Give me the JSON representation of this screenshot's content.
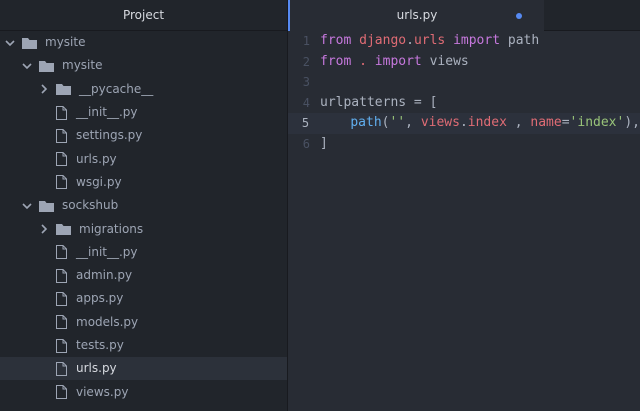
{
  "sidebar": {
    "title": "Project",
    "tree": [
      {
        "label": "mysite",
        "type": "folder",
        "depth": 0,
        "expanded": true
      },
      {
        "label": "mysite",
        "type": "folder",
        "depth": 1,
        "expanded": true
      },
      {
        "label": "__pycache__",
        "type": "folder",
        "depth": 2,
        "expanded": false
      },
      {
        "label": "__init__.py",
        "type": "file",
        "depth": 2
      },
      {
        "label": "settings.py",
        "type": "file",
        "depth": 2
      },
      {
        "label": "urls.py",
        "type": "file",
        "depth": 2
      },
      {
        "label": "wsgi.py",
        "type": "file",
        "depth": 2
      },
      {
        "label": "sockshub",
        "type": "folder",
        "depth": 1,
        "expanded": true
      },
      {
        "label": "migrations",
        "type": "folder",
        "depth": 2,
        "expanded": false
      },
      {
        "label": "__init__.py",
        "type": "file",
        "depth": 2
      },
      {
        "label": "admin.py",
        "type": "file",
        "depth": 2
      },
      {
        "label": "apps.py",
        "type": "file",
        "depth": 2
      },
      {
        "label": "models.py",
        "type": "file",
        "depth": 2
      },
      {
        "label": "tests.py",
        "type": "file",
        "depth": 2
      },
      {
        "label": "urls.py",
        "type": "file",
        "depth": 2,
        "selected": true
      },
      {
        "label": "views.py",
        "type": "file",
        "depth": 2
      }
    ]
  },
  "editor": {
    "tab": {
      "label": "urls.py",
      "modified": true
    },
    "current_line": 5,
    "lines": [
      {
        "num": "1",
        "tokens": [
          {
            "t": "from",
            "c": "kw"
          },
          {
            "t": " ",
            "c": "plain"
          },
          {
            "t": "django",
            "c": "mod"
          },
          {
            "t": ".",
            "c": "plain"
          },
          {
            "t": "urls",
            "c": "mod"
          },
          {
            "t": " ",
            "c": "plain"
          },
          {
            "t": "import",
            "c": "kw"
          },
          {
            "t": " path",
            "c": "plain"
          }
        ]
      },
      {
        "num": "2",
        "tokens": [
          {
            "t": "from",
            "c": "kw"
          },
          {
            "t": " ",
            "c": "plain"
          },
          {
            "t": ".",
            "c": "mod"
          },
          {
            "t": " ",
            "c": "plain"
          },
          {
            "t": "import",
            "c": "kw"
          },
          {
            "t": " views",
            "c": "plain"
          }
        ]
      },
      {
        "num": "3",
        "tokens": []
      },
      {
        "num": "4",
        "tokens": [
          {
            "t": "urlpatterns",
            "c": "plain"
          },
          {
            "t": " = ",
            "c": "plain"
          },
          {
            "t": "[",
            "c": "plain"
          }
        ]
      },
      {
        "num": "5",
        "tokens": [
          {
            "t": "    ",
            "c": "plain"
          },
          {
            "t": "path",
            "c": "fn"
          },
          {
            "t": "(",
            "c": "plain"
          },
          {
            "t": "''",
            "c": "str"
          },
          {
            "t": ", ",
            "c": "plain"
          },
          {
            "t": "views",
            "c": "mod"
          },
          {
            "t": ".",
            "c": "plain"
          },
          {
            "t": "index",
            "c": "mod"
          },
          {
            "t": " , ",
            "c": "plain"
          },
          {
            "t": "name",
            "c": "mod"
          },
          {
            "t": "=",
            "c": "plain"
          },
          {
            "t": "'index'",
            "c": "str"
          },
          {
            "t": "),",
            "c": "plain"
          }
        ]
      },
      {
        "num": "6",
        "tokens": [
          {
            "t": "]",
            "c": "plain"
          }
        ]
      }
    ]
  },
  "colors": {
    "accent": "#568af2",
    "sidebar_bg": "#21252b",
    "editor_bg": "#282c34",
    "selection_bg": "#2c313a"
  }
}
